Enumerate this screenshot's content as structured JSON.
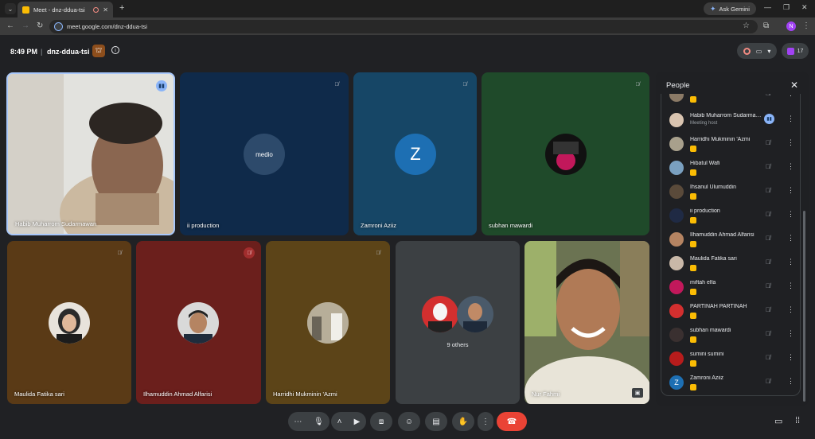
{
  "browser": {
    "tab_title": "Meet - dnz-ddua-tsi",
    "url": "meet.google.com/dnz-ddua-tsi",
    "gemini_label": "Ask Gemini",
    "profile_initial": "N"
  },
  "meeting": {
    "time": "8:49 PM",
    "separator": "|",
    "code": "dnz-ddua-tsi",
    "participant_count": "17"
  },
  "tiles": [
    {
      "name": "Habib Muharrom Sudarmawan",
      "state": "speaking"
    },
    {
      "name": "ii production",
      "avatar_text": "medio"
    },
    {
      "name": "Zamroni Aziiz",
      "avatar_text": "Z"
    },
    {
      "name": "subhan mawardi"
    },
    {
      "name": "Maulida Fatika sari"
    },
    {
      "name": "Ilhamuddin Ahmad Alfarisi"
    },
    {
      "name": "Harridhi Mukminin 'Azmi"
    },
    {
      "name": "9 others"
    },
    {
      "name": "Nur Fahmi"
    }
  ],
  "people_panel": {
    "title": "People",
    "participants": [
      {
        "name": "Habib Muharrom Sudarmawan",
        "sub": "Meeting host",
        "speaking": true
      },
      {
        "name": "Harridhi Mukminin 'Azmi"
      },
      {
        "name": "Hibatul Wafi"
      },
      {
        "name": "Ihsanul Ulumuddin"
      },
      {
        "name": "ii production"
      },
      {
        "name": "Ilhamuddin Ahmad Alfarisi"
      },
      {
        "name": "Maulida Fatika sari"
      },
      {
        "name": "miftah elfa"
      },
      {
        "name": "PARTINAH PARTINAH"
      },
      {
        "name": "subhan mawardi"
      },
      {
        "name": "sumini sumini"
      },
      {
        "name": "Zamroni Aziiz",
        "avatar_text": "Z"
      }
    ]
  },
  "colors": {
    "accent": "#8ab4f8",
    "end_call": "#ea4335",
    "raise_hand": "#fbbc04"
  }
}
